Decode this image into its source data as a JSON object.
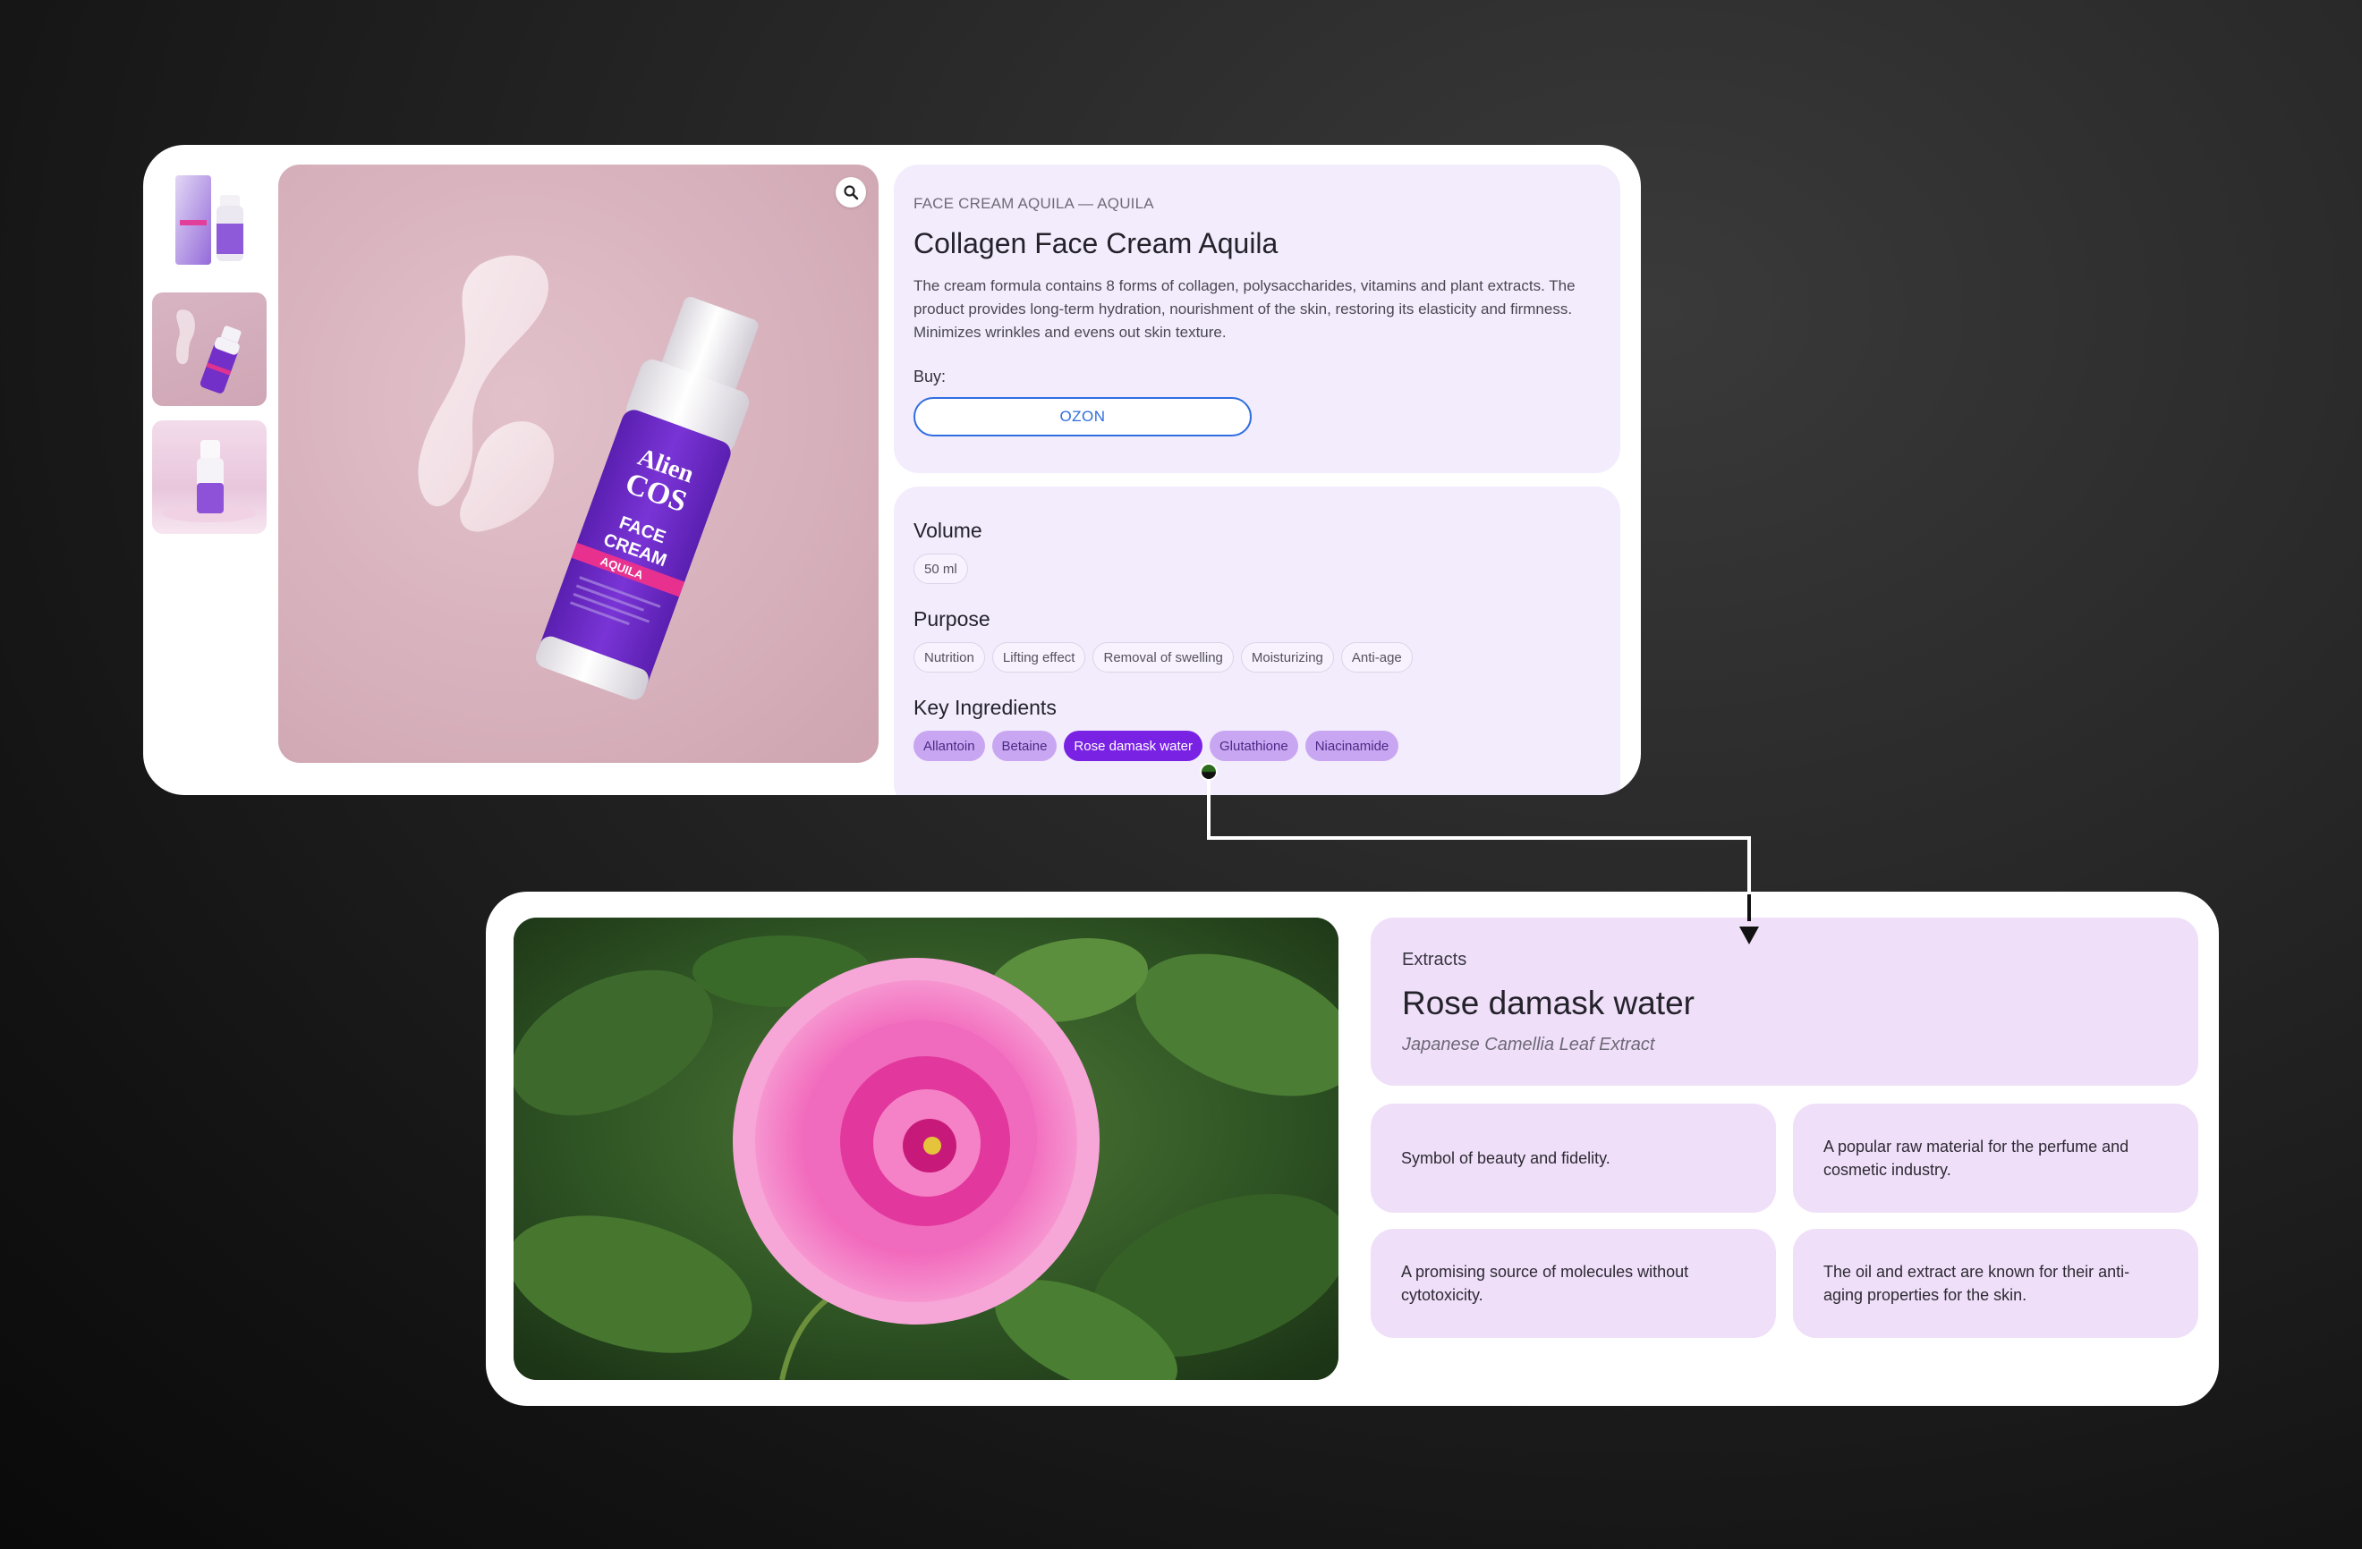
{
  "product": {
    "breadcrumb": "FACE CREAM AQUILA — AQUILA",
    "title": "Collagen Face Cream Aquila",
    "description": "The cream formula contains 8 forms of collagen, polysaccharides, vitamins and plant extracts. The product provides long-term hydration, nourishment of the skin, restoring its elasticity and firmness. Minimizes wrinkles and evens out skin texture.",
    "buy_label": "Buy:",
    "buy_button": "OZON",
    "brand_line1": "Alien",
    "brand_line2": "COS",
    "bottle_line1": "FACE",
    "bottle_line2": "CREAM",
    "bottle_band": "AQUILA"
  },
  "attributes": {
    "volume_title": "Volume",
    "volume_options": [
      "50 ml"
    ],
    "purpose_title": "Purpose",
    "purposes": [
      "Nutrition",
      "Lifting effect",
      "Removal of swelling",
      "Moisturizing",
      "Anti-age"
    ],
    "ingredients_title": "Key Ingredients",
    "ingredients": [
      "Allantoin",
      "Betaine",
      "Rose damask water",
      "Glutathione",
      "Niacinamide"
    ],
    "active_ingredient": "Rose damask water"
  },
  "ingredient_detail": {
    "category": "Extracts",
    "title": "Rose damask water",
    "latin": "Japanese Camellia Leaf Extract",
    "facts": [
      "Symbol of beauty and fidelity.",
      "A popular raw material for the perfume and cosmetic industry.",
      "A promising source of molecules without cytotoxicity.",
      "The oil and extract are known for their anti-aging properties for the skin."
    ]
  },
  "icons": {
    "zoom": "magnifier-icon"
  },
  "colors": {
    "accent_purple": "#7a22e3",
    "chip_purple": "#c9a6f1",
    "panel_lilac": "#f3ecfc",
    "ozon_blue": "#2f6de1"
  }
}
